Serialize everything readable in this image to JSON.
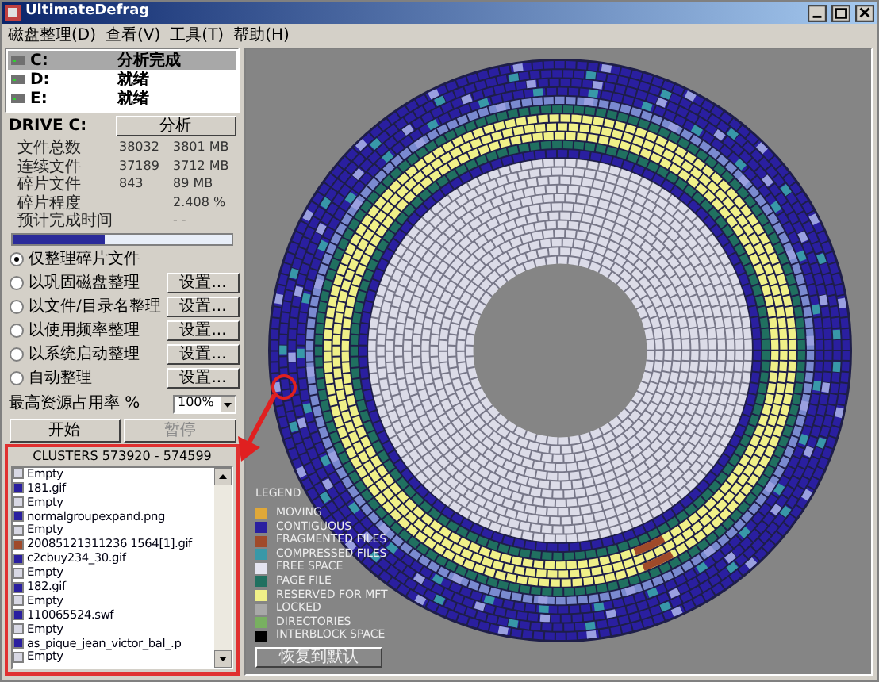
{
  "window": {
    "title": "UltimateDefrag"
  },
  "menu": [
    "磁盘整理(D)",
    "查看(V)",
    "工具(T)",
    "帮助(H)"
  ],
  "drives": [
    {
      "letter": "C:",
      "status": "分析完成",
      "selected": true
    },
    {
      "letter": "D:",
      "status": "就绪",
      "selected": false
    },
    {
      "letter": "E:",
      "status": "就绪",
      "selected": false
    }
  ],
  "drive_label": "DRIVE C:",
  "analyze_button": "分析",
  "stats": [
    {
      "label": "文件总数",
      "count": "38032",
      "size": "3801 MB"
    },
    {
      "label": "连续文件",
      "count": "37189",
      "size": "3712 MB"
    },
    {
      "label": "碎片文件",
      "count": "843",
      "size": "89 MB"
    },
    {
      "label": "碎片程度",
      "size": "2.408 %"
    },
    {
      "label": "预计完成时间",
      "size": "- -"
    }
  ],
  "progress": {
    "level": 0.42
  },
  "modes": [
    {
      "label": "仅整理碎片文件",
      "selected": true
    },
    {
      "label": "以巩固磁盘整理",
      "selected": false,
      "settings_button": "设置..."
    },
    {
      "label": "以文件/目录名整理",
      "selected": false,
      "settings_button": "设置..."
    },
    {
      "label": "以使用频率整理",
      "selected": false,
      "settings_button": "设置..."
    },
    {
      "label": "以系统启动整理",
      "selected": false,
      "settings_button": "设置..."
    },
    {
      "label": "自动整理",
      "selected": false,
      "settings_button": "设置..."
    }
  ],
  "max_usage": {
    "label": "最高资源占用率 %",
    "value": "100%"
  },
  "start_button": {
    "label": "开始",
    "disabled": false
  },
  "pause_button": {
    "label": "暂停",
    "disabled": true
  },
  "clusters": {
    "title": "CLUSTERS 573920 - 574599",
    "items": [
      {
        "name": "Empty",
        "color": "#d8d8e4"
      },
      {
        "name": "181.gif",
        "color": "#2a1fa0"
      },
      {
        "name": "Empty",
        "color": "#d8d8e4"
      },
      {
        "name": "normalgroupexpand.png",
        "color": "#2a1fa0"
      },
      {
        "name": "Empty",
        "color": "#d8d8e4"
      },
      {
        "name": "20085121311236 1564[1].gif",
        "color": "#a04a2a"
      },
      {
        "name": "c2cbuy234_30.gif",
        "color": "#2a1fa0"
      },
      {
        "name": "Empty",
        "color": "#d8d8e4"
      },
      {
        "name": "182.gif",
        "color": "#2a1fa0"
      },
      {
        "name": "Empty",
        "color": "#d8d8e4"
      },
      {
        "name": "110065524.swf",
        "color": "#2a1fa0"
      },
      {
        "name": "Empty",
        "color": "#d8d8e4"
      },
      {
        "name": "as_pique_jean_victor_bal_.p",
        "color": "#2a1fa0"
      },
      {
        "name": "Empty",
        "color": "#d8d8e4"
      }
    ]
  },
  "legend": {
    "title": "LEGEND",
    "items": [
      {
        "label": "MOVING",
        "color": "#e0a838"
      },
      {
        "label": "CONTIGUOUS",
        "color": "#2a1fa0"
      },
      {
        "label": "FRAGMENTED FILES",
        "color": "#a04a2a"
      },
      {
        "label": "COMPRESSED FILES",
        "color": "#3898a8"
      },
      {
        "label": "FREE SPACE",
        "color": "#e4e4f0"
      },
      {
        "label": "PAGE FILE",
        "color": "#207060"
      },
      {
        "label": "RESERVED FOR MFT",
        "color": "#f0f088"
      },
      {
        "label": "LOCKED",
        "color": "#a8a8a8"
      },
      {
        "label": "DIRECTORIES",
        "color": "#78b060"
      },
      {
        "label": "INTERBLOCK SPACE",
        "color": "#000000"
      }
    ],
    "reset_button": "恢复到默认"
  }
}
